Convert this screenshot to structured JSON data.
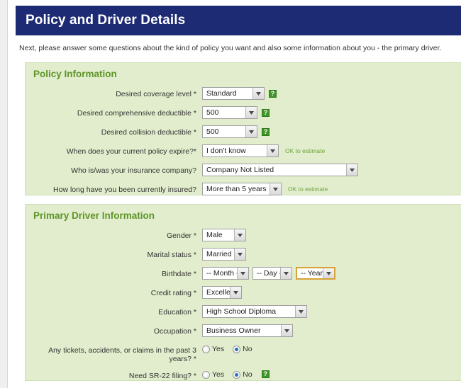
{
  "header": {
    "title": "Policy and Driver Details",
    "bar_color": "#1d2a74"
  },
  "intro": "Next, please answer some questions about the kind of policy you want and also some information about you - the primary driver.",
  "panels": [
    {
      "legend": "Policy Information",
      "rows": [
        {
          "label": "Desired coverage level *",
          "control": "select",
          "value": "Standard",
          "help": "?",
          "note": ""
        },
        {
          "label": "Desired comprehensive deductible *",
          "control": "select",
          "value": "500",
          "help": "?",
          "note": ""
        },
        {
          "label": "Desired collision deductible *",
          "control": "select",
          "value": "500",
          "help": "?",
          "note": ""
        },
        {
          "label": "When does your current policy expire?*",
          "control": "select",
          "value": "I don't know",
          "help": "",
          "note": "OK to estimate"
        },
        {
          "label": "Who is/was your insurance company?",
          "control": "select",
          "value": "Company Not Listed",
          "help": "",
          "note": ""
        },
        {
          "label": "How long have you been currently insured?",
          "control": "select",
          "value": "More than 5 years",
          "help": "",
          "note": "OK to estimate"
        }
      ]
    },
    {
      "legend": "Primary Driver Information",
      "rows": [
        {
          "label": "Gender *",
          "control": "select",
          "value": "Male",
          "help": "",
          "note": ""
        },
        {
          "label": "Marital status *",
          "control": "select",
          "value": "Married",
          "help": "",
          "note": ""
        },
        {
          "label": "Birthdate *",
          "control": "date",
          "month": "-- Month --",
          "day": "-- Day --",
          "year": "-- Year --",
          "help": "",
          "note": ""
        },
        {
          "label": "Credit rating *",
          "control": "select",
          "value": "Excellent",
          "help": "",
          "note": ""
        },
        {
          "label": "Education *",
          "control": "select",
          "value": "High School Diploma",
          "help": "",
          "note": ""
        },
        {
          "label": "Occupation *",
          "control": "select",
          "value": "Business Owner",
          "help": "",
          "note": ""
        },
        {
          "label": "Any tickets, accidents, or claims in the past 3 years? *",
          "control": "radio",
          "options": [
            "Yes",
            "No"
          ],
          "selected": "No",
          "help": "",
          "note": ""
        },
        {
          "label": "Need SR-22 filing? *",
          "control": "radio",
          "options": [
            "Yes",
            "No"
          ],
          "selected": "No",
          "help": "?",
          "note": ""
        }
      ]
    }
  ],
  "colors": {
    "header_blue": "#1d2a74",
    "panel_green_bg": "#e1edcc",
    "panel_border": "#cfe0b4",
    "legend_green": "#5e9428",
    "note_green": "#6fa33c",
    "help_green": "#3f9628",
    "highlight_border": "#d8a23a",
    "radio_dot_blue": "#2c6fbb"
  }
}
